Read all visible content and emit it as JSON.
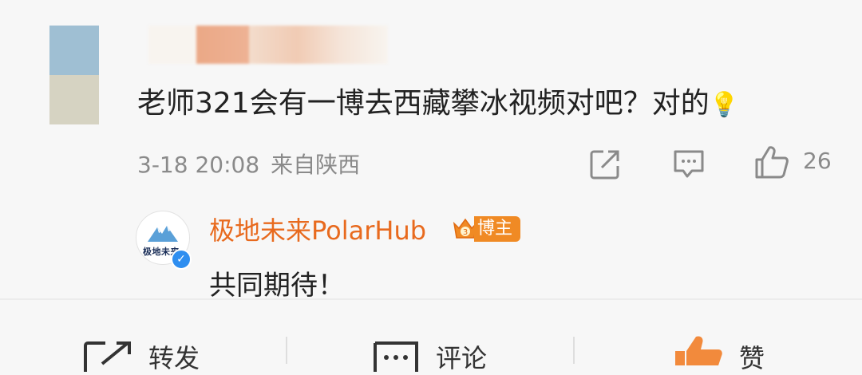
{
  "comment": {
    "text": "老师321会有一博去西藏攀冰视频对吧？对的",
    "emoji": "💡",
    "time": "3-18 20:08",
    "location": "来自陕西",
    "like_count": "26",
    "icons": [
      "share-icon",
      "comment-icon",
      "like-icon"
    ]
  },
  "reply": {
    "author": "极地未来PolarHub",
    "badge": "博主",
    "avatar_text": "极地未来",
    "text": "共同期待！"
  },
  "bottom_bar": {
    "repost": "转发",
    "comment": "评论",
    "like": "赞"
  },
  "colors": {
    "accent_orange": "#e86a1e",
    "badge_orange": "#f08a24",
    "meta_gray": "#8a8a8a",
    "verified_blue": "#2e8ef0"
  }
}
